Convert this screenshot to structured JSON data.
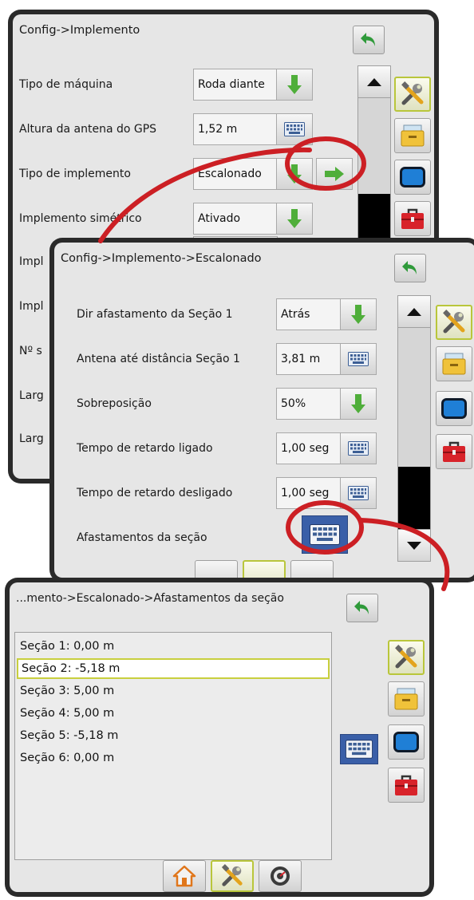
{
  "panel1": {
    "title": "Config->Implemento",
    "rows": [
      {
        "label": "Tipo de máquina",
        "value": "Roda diante",
        "action": "down-arrow-icon"
      },
      {
        "label": "Altura da antena do GPS",
        "value": "1,52 m",
        "action": "keyboard-icon"
      },
      {
        "label": "Tipo de implemento",
        "value": "Escalonado",
        "action": "right-arrow-icon"
      },
      {
        "label": "Implemento simétrico",
        "value": "Ativado",
        "action": "down-arrow-icon"
      },
      {
        "label": "Impl"
      },
      {
        "label": "Impl"
      },
      {
        "label": "Nº s"
      },
      {
        "label": "Larg"
      },
      {
        "label": "Larg"
      }
    ]
  },
  "panel2": {
    "title": "Config->Implemento->Escalonado",
    "rows": [
      {
        "label": "Dir afastamento da Seção 1",
        "value": "Atrás",
        "action": "down-arrow-icon"
      },
      {
        "label": "Antena até distância Seção 1",
        "value": "3,81 m",
        "action": "keyboard-icon"
      },
      {
        "label": "Sobreposição",
        "value": "50%",
        "action": "down-arrow-icon"
      },
      {
        "label": "Tempo de retardo ligado",
        "value": "1,00 seg",
        "action": "keyboard-icon"
      },
      {
        "label": "Tempo de retardo desligado",
        "value": "1,00 seg",
        "action": "keyboard-icon"
      },
      {
        "label": "Afastamentos da seção",
        "action": "keyboard-icon"
      }
    ]
  },
  "panel3": {
    "title": "...mento->Escalonado->Afastamentos da seção",
    "items": [
      "Seção 1: 0,00 m",
      "Seção 2: -5,18 m",
      "Seção 3: 5,00 m",
      "Seção 4: 5,00 m",
      "Seção 5: -5,18 m",
      "Seção 6: 0,00 m"
    ],
    "selected_index": 1
  },
  "side_tabs": [
    "tools-icon",
    "data-drawer-icon",
    "screen-icon",
    "toolbox-icon"
  ],
  "bottom_tabs": [
    "home-icon",
    "tools-icon",
    "gauge-icon"
  ],
  "colors": {
    "accent_green": "#b9c63b",
    "callout_red": "#cc1f24",
    "arrow_green": "#4fae3a",
    "back_arrow_green": "#2f9a3a",
    "bezel": "#2a2a2a",
    "screen_bg": "#e6e6e6"
  }
}
